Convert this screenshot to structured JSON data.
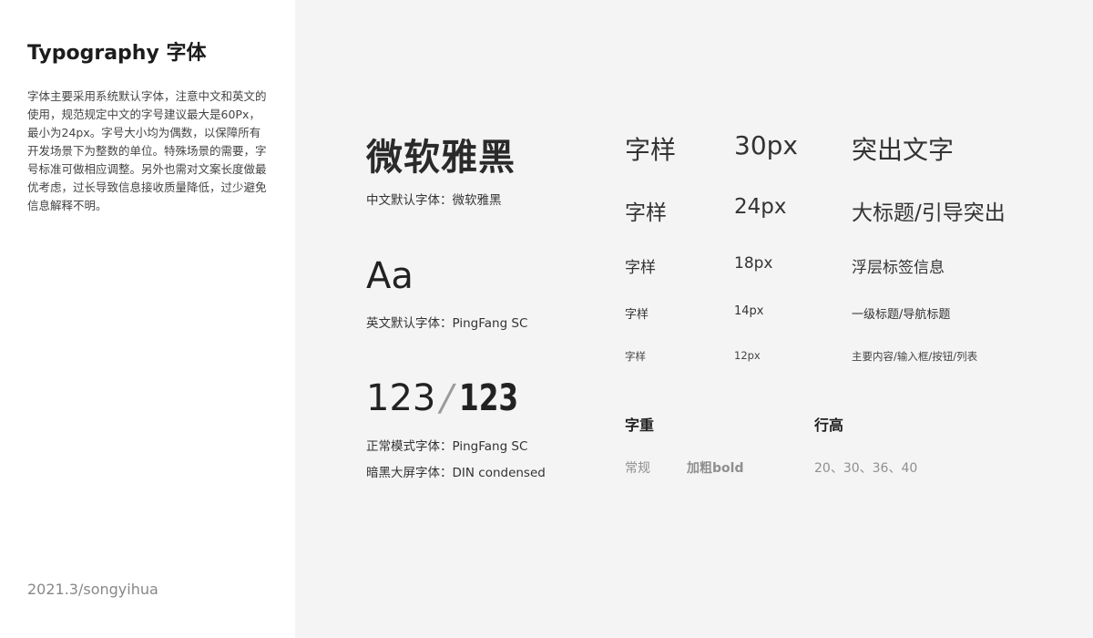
{
  "sidebar": {
    "title": "Typography 字体",
    "description": "字体主要采用系统默认字体，注意中文和英文的使用，规范规定中文的字号建议最大是60Px，最小为24px。字号大小均为偶数，以保障所有开发场景下为整数的单位。特殊场景的需要，字号标准可做相应调整。另外也需对文案长度做最优考虑，过长导致信息接收质量降低，过少避免信息解释不明。",
    "footer": "2021.3/songyihua"
  },
  "fonts": {
    "chinese_sample": "微软雅黑",
    "chinese_caption": "中文默认字体：微软雅黑",
    "english_sample": "Aa",
    "english_caption": "英文默认字体：PingFang SC",
    "number_sample_regular": "123",
    "number_sample_slash": "/",
    "number_sample_condensed": "123",
    "number_caption_normal": "正常模式字体：PingFang SC",
    "number_caption_dark": "暗黑大屏字体：DIN condensed"
  },
  "sizes": [
    {
      "sample": "字样",
      "size": "30px",
      "usage": "突出文字"
    },
    {
      "sample": "字样",
      "size": "24px",
      "usage": "大标题/引导突出"
    },
    {
      "sample": "字样",
      "size": "18px",
      "usage": "浮层标签信息"
    },
    {
      "sample": "字样",
      "size": "14px",
      "usage": "一级标题/导航标题"
    },
    {
      "sample": "字样",
      "size": "12px",
      "usage": "主要内容/输入框/按钮/列表"
    }
  ],
  "weight": {
    "heading": "字重",
    "regular": "常规",
    "bold": "加粗bold"
  },
  "line_height": {
    "heading": "行高",
    "values": "20、30、36、40"
  }
}
